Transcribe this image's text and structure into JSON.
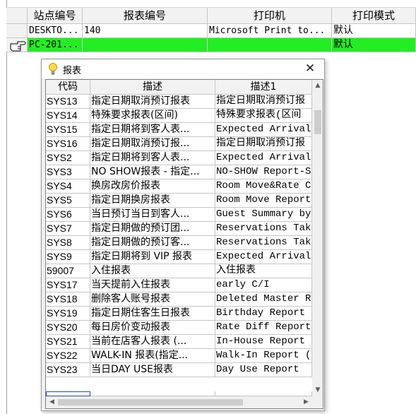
{
  "main_grid": {
    "columns": [
      "站点编号",
      "报表编号",
      "打印机",
      "打印模式"
    ],
    "rows": [
      {
        "station": "DESKTO...",
        "report": "140",
        "printer": "Microsoft Print to...",
        "mode": "默认"
      },
      {
        "station": "PC-201...",
        "report": "",
        "printer": "",
        "mode": "默认"
      }
    ]
  },
  "dialog": {
    "title": "报表",
    "columns": [
      "代码",
      "描述",
      "描述1"
    ],
    "rows": [
      {
        "code": "SYS13",
        "desc": "指定日期取消预订报表",
        "desc1": "指定日期取消预订报"
      },
      {
        "code": "SYS14",
        "desc": "特殊要求报表(区间)",
        "desc1": "特殊要求报表(区间"
      },
      {
        "code": "SYS15",
        "desc": "指定日期将到客人表...",
        "desc1": "Expected Arrivals"
      },
      {
        "code": "SYS16",
        "desc": "指定日期取消预订报...",
        "desc1": "指定日期取消预订报"
      },
      {
        "code": "SYS2",
        "desc": "指定日期将到客人表...",
        "desc1": "Expected Arrivals"
      },
      {
        "code": "SYS3",
        "desc": "NO SHOW报表 - 指定...",
        "desc1": "NO-SHOW Report-Sp"
      },
      {
        "code": "SYS4",
        "desc": "换房改房价报表",
        "desc1": "Room Move&Rate Ch"
      },
      {
        "code": "SYS5",
        "desc": "指定日期换房报表",
        "desc1": "Room Move  Report"
      },
      {
        "code": "SYS6",
        "desc": "当日预订当日到客人...",
        "desc1": "Guest Summary by"
      },
      {
        "code": "SYS7",
        "desc": "指定日期做的预订团...",
        "desc1": "Reservations Take"
      },
      {
        "code": "SYS8",
        "desc": "指定日期做的预订客...",
        "desc1": "Reservations Take"
      },
      {
        "code": "SYS9",
        "desc": "指定日期将到 VIP 报表",
        "desc1": "Expected Arrivals"
      },
      {
        "code": "59007",
        "desc": "入住报表",
        "desc1": "入住报表"
      },
      {
        "code": "SYS17",
        "desc": "当天提前入住报表",
        "desc1": "early C/I"
      },
      {
        "code": "SYS18",
        "desc": "删除客人账号报表",
        "desc1": "Deleted Master Re"
      },
      {
        "code": "SYS19",
        "desc": "指定日期住客生日报表",
        "desc1": "Birthday Report ("
      },
      {
        "code": "SYS20",
        "desc": "每日房价变动报表",
        "desc1": "Rate Diff Report("
      },
      {
        "code": "SYS21",
        "desc": "当前在店客人报表 (...",
        "desc1": "In-House Report ("
      },
      {
        "code": "SYS22",
        "desc": "WALK-IN 报表(指定...",
        "desc1": "Walk-In Report (B"
      },
      {
        "code": "SYS23",
        "desc": "当日DAY USE报表",
        "desc1": "Day Use Report"
      }
    ]
  },
  "colors": {
    "selected_row": "#22ee22",
    "header_bg": "#f2f2f2"
  },
  "icons": [
    "hand-pointer-icon",
    "lightbulb-icon",
    "close-icon",
    "scroll-up-icon",
    "scroll-down-icon",
    "scroll-left-icon",
    "scroll-right-icon"
  ]
}
